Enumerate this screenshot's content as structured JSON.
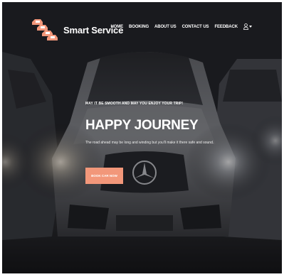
{
  "brand": {
    "name": "Smart Service",
    "logo_icon": "stacked-cars-logo-icon"
  },
  "nav": {
    "items": [
      {
        "label": "HOME"
      },
      {
        "label": "BOOKING"
      },
      {
        "label": "ABOUT US"
      },
      {
        "label": "CONTACT US"
      },
      {
        "label": "FEEDBACK"
      }
    ],
    "user_icon": "user-icon",
    "dropdown_icon": "caret-down-icon"
  },
  "hero": {
    "tagline": "MAY IT BE SMOOTH AND MAY YOU ENJOY YOUR TRIP!",
    "title": "HAPPY JOURNEY",
    "description": "The road ahead may be long and winding but you'll make it there safe and sound.",
    "button_label": "BOOK CAR NOW"
  },
  "colors": {
    "accent": "#f2977a",
    "text": "#ffffff",
    "background": "#1c1d20"
  }
}
